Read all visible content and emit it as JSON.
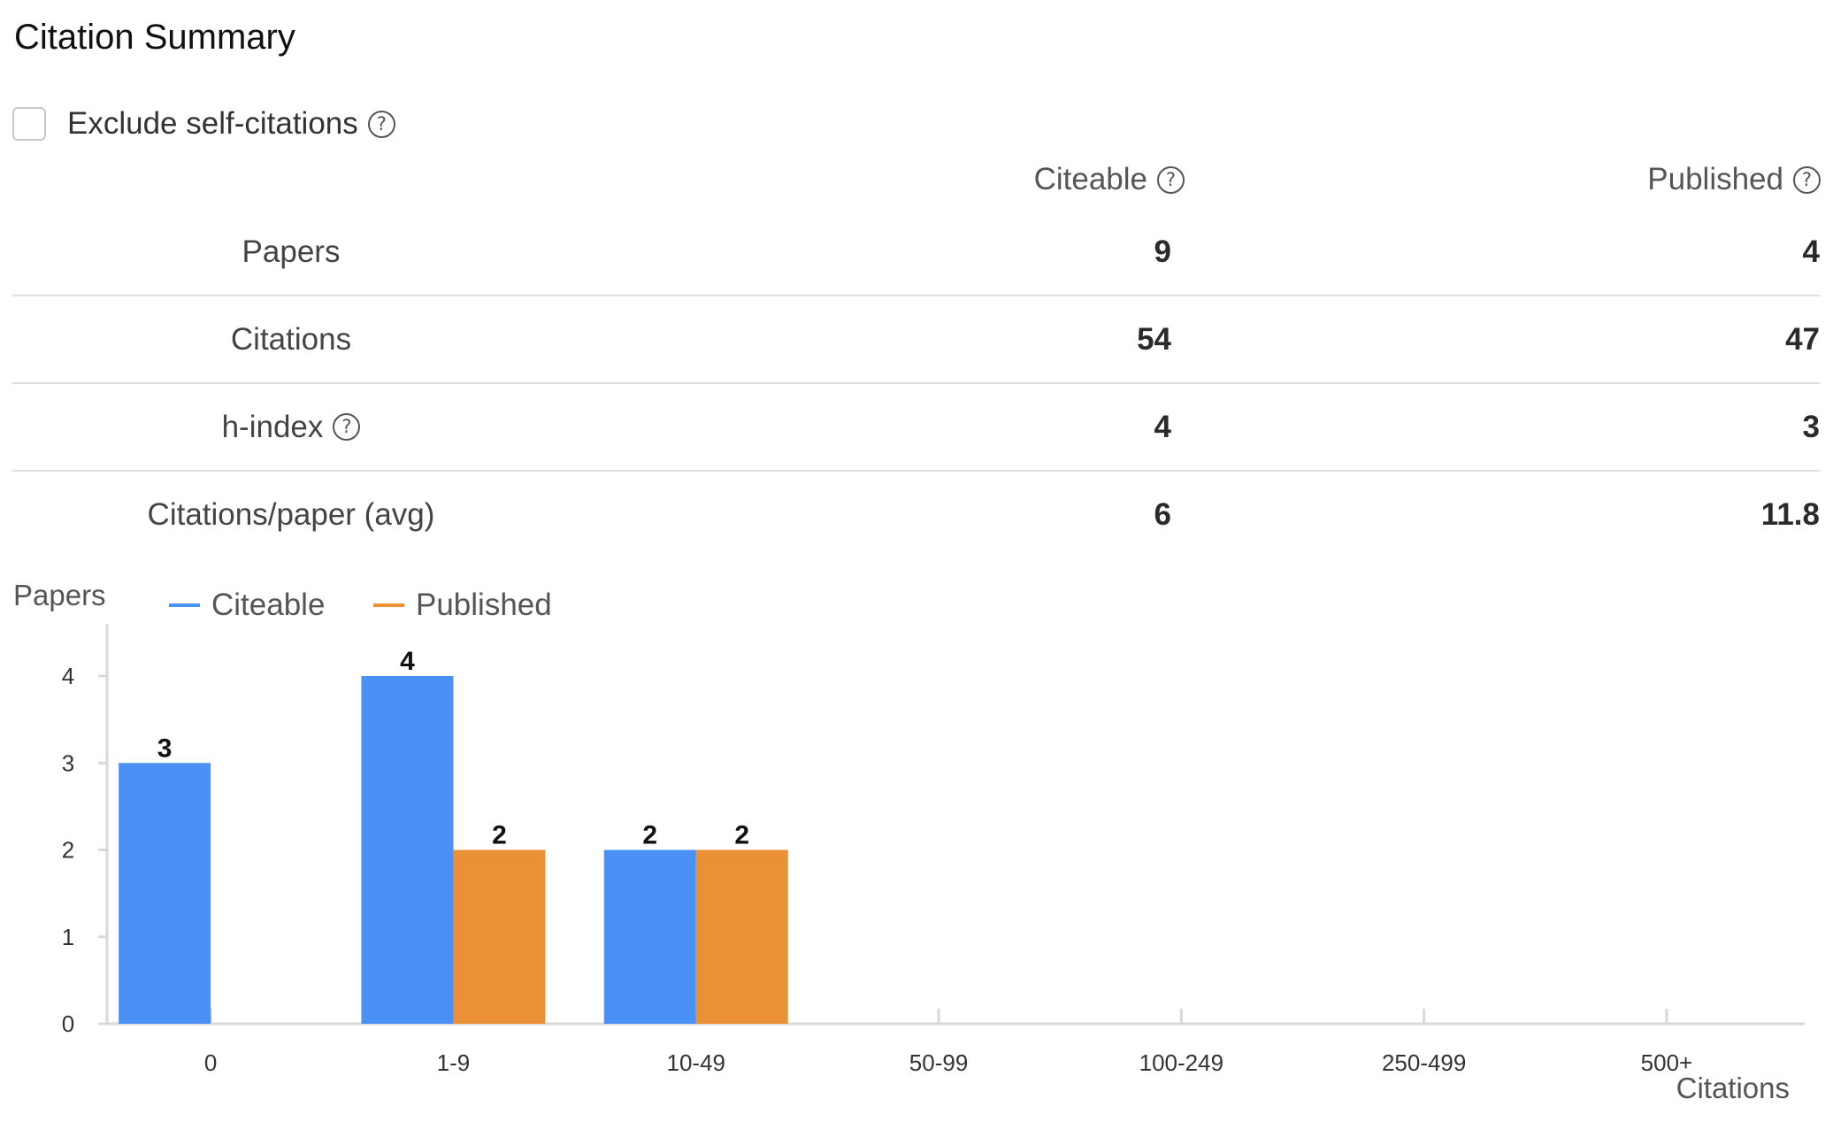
{
  "title": "Citation Summary",
  "exclude_label": "Exclude self-citations",
  "columns": [
    "Citeable",
    "Published"
  ],
  "rows": [
    {
      "label": "Papers",
      "citeable": "9",
      "published": "4"
    },
    {
      "label": "Citations",
      "citeable": "54",
      "published": "47"
    },
    {
      "label": "h-index",
      "citeable": "4",
      "published": "3"
    },
    {
      "label": "Citations/paper (avg)",
      "citeable": "6",
      "published": "11.8"
    }
  ],
  "colors": {
    "citeable": "#4a90f5",
    "published": "#ea9138"
  },
  "chart_data": {
    "type": "bar",
    "ylabel": "Papers",
    "xlabel": "Citations",
    "categories": [
      "0",
      "1-9",
      "10-49",
      "50-99",
      "100-249",
      "250-499",
      "500+"
    ],
    "series": [
      {
        "name": "Citeable",
        "values": [
          3,
          4,
          2,
          0,
          0,
          0,
          0
        ]
      },
      {
        "name": "Published",
        "values": [
          0,
          2,
          2,
          0,
          0,
          0,
          0
        ]
      }
    ],
    "ylim": [
      0,
      4
    ],
    "yticks": [
      0,
      1,
      2,
      3,
      4
    ],
    "legend": "top-left",
    "grid": false
  }
}
